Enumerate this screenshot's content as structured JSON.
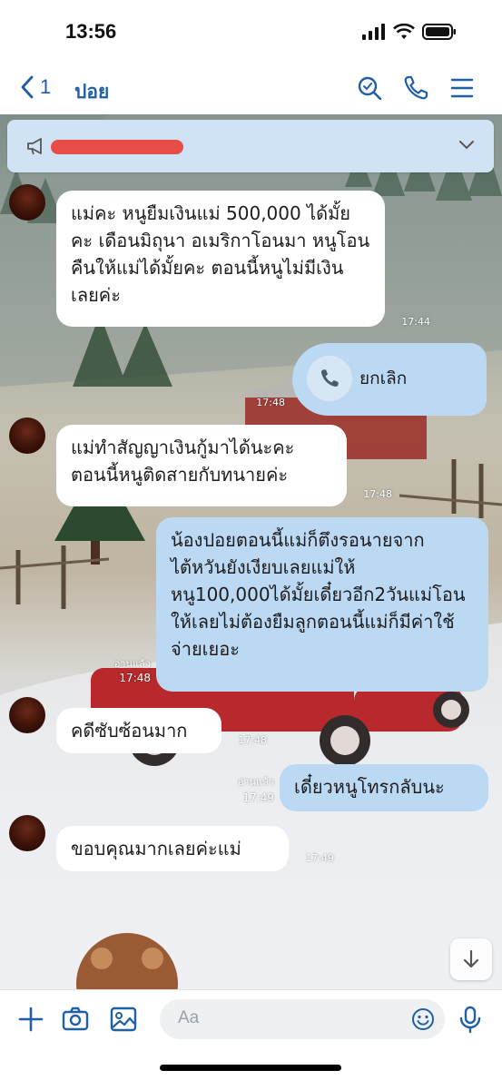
{
  "status_bar": {
    "time": "13:56"
  },
  "header": {
    "back_count": "1",
    "title": "ปอย"
  },
  "messages": {
    "m1": {
      "text": "แม่คะ หนูยืมเงินแม่ 500,000 ได้มั้ยคะ เดือนมิถุนา อเมริกาโอนมา หนูโอนคืนให้แม่ได้มั้ยคะ ตอนนี้หนูไม่มีเงินเลยค่ะ",
      "time": "17:44"
    },
    "m2": {
      "text": "ยกเลิก",
      "time": "17:48"
    },
    "m3": {
      "text": "แม่ทำสัญญาเงินกู้มาได้นะคะ ตอนนี้หนูติดสายกับทนายค่ะ",
      "time": "17:48"
    },
    "m4": {
      "text": "น้องปอยตอนนี้แม่ก็ตึงรอนายจากไต้หวันยังเงียบเลยแม่ให้หนู100,000ได้มั้ยเดี๋ยวอีก2วันแม่โอนให้เลยไม่ต้องยืมลูกตอนนี้แม่ก็มีค่าใช้จ่ายเยอะ",
      "read": "อ่านแล้ว",
      "time": "17:48"
    },
    "m5": {
      "text": "คดีซับซ้อนมาก",
      "time": "17:48"
    },
    "m6": {
      "text": "เดี๋ยวหนูโทรกลับนะ",
      "read": "อ่านแล้ว",
      "time": "17:49"
    },
    "m7": {
      "text": "ขอบคุณมากเลยค่ะแม่",
      "time": "17:49"
    }
  },
  "composer": {
    "placeholder": "Aa"
  },
  "colors": {
    "accent": "#1f5fa6",
    "bubble_sent": "#bcd9f3",
    "bubble_received": "#ffffff",
    "announce_bg": "#cfe3f5"
  },
  "icons": [
    "back-chevron-icon",
    "search-icon",
    "phone-icon",
    "menu-icon",
    "megaphone-icon",
    "chevron-down-icon",
    "plus-icon",
    "camera-icon",
    "image-icon",
    "emoji-icon",
    "mic-icon",
    "scroll-down-icon"
  ]
}
